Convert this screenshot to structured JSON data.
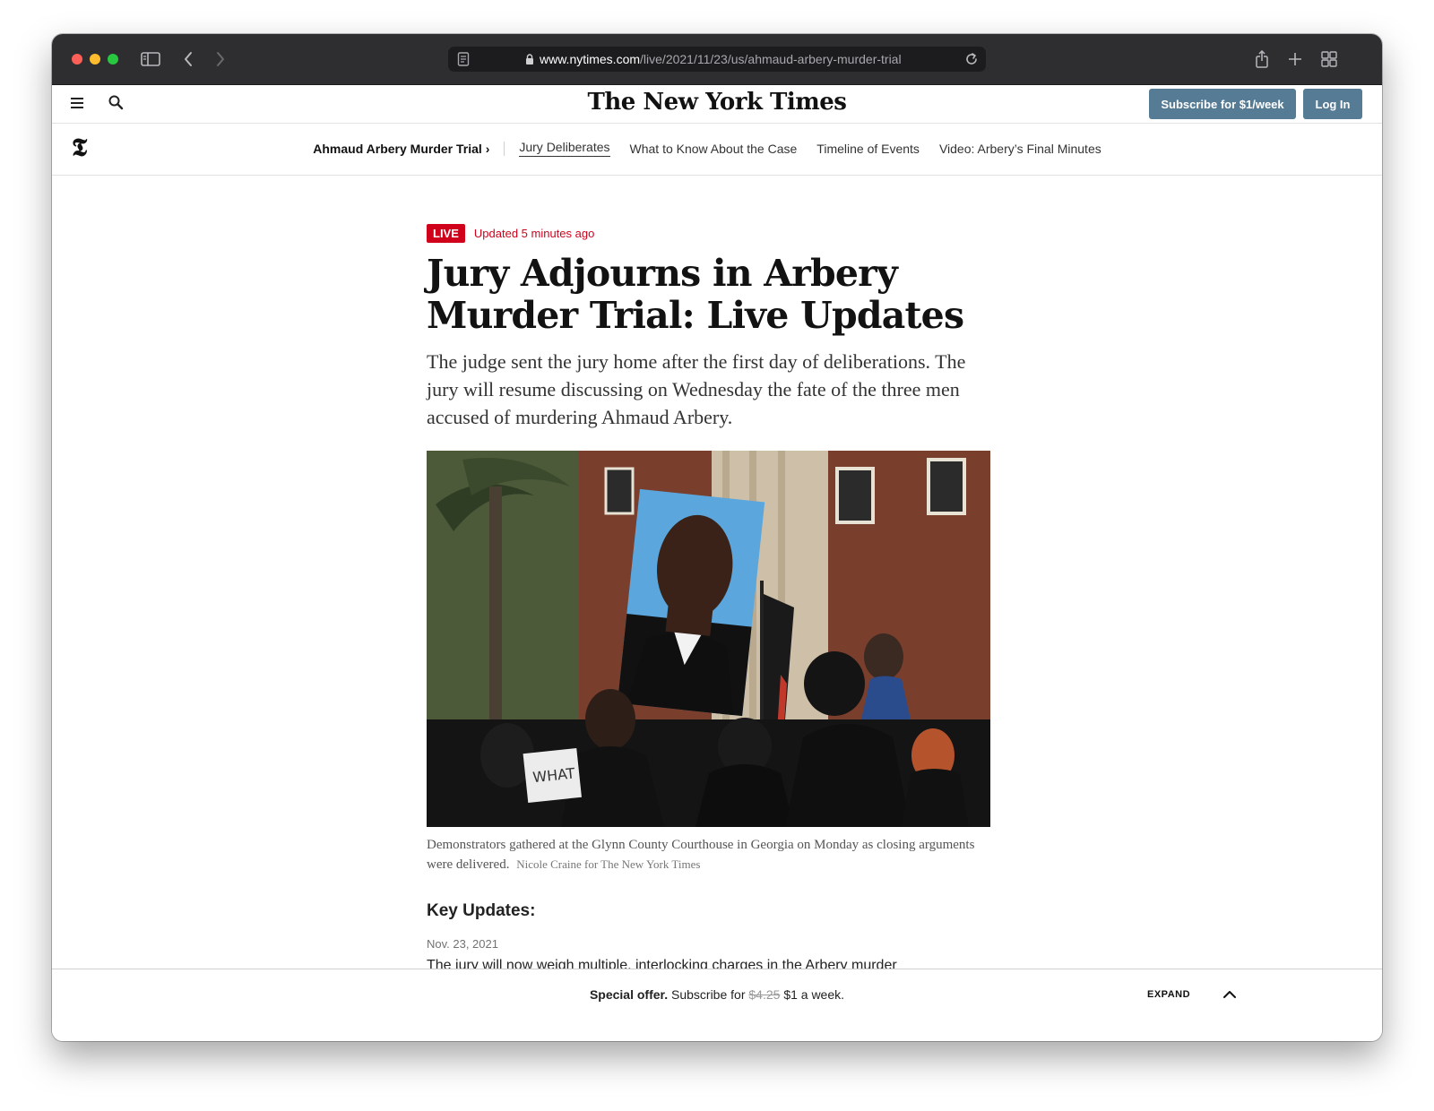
{
  "browser": {
    "url_domain": "www.nytimes.com",
    "url_path": "/live/2021/11/23/us/ahmaud-arbery-murder-trial",
    "icons": [
      "sidebar-icon",
      "back-icon",
      "forward-icon",
      "reader-icon",
      "lock-icon",
      "reload-icon",
      "share-icon",
      "new-tab-icon",
      "tab-overview-icon"
    ]
  },
  "header": {
    "masthead": "The New York Times",
    "subscribe_label": "Subscribe for $1/week",
    "login_label": "Log In",
    "accent_color": "#567b95"
  },
  "section_nav": {
    "trial_label": "Ahmaud Arbery Murder Trial",
    "trial_chevron": "›",
    "items": [
      {
        "label": "Jury Deliberates",
        "active": true
      },
      {
        "label": "What to Know About the Case",
        "active": false
      },
      {
        "label": "Timeline of Events",
        "active": false
      },
      {
        "label": "Video: Arbery’s Final Minutes",
        "active": false
      }
    ]
  },
  "article": {
    "live_label": "LIVE",
    "updated": "Updated 5 minutes ago",
    "headline": "Jury Adjourns in Arbery Murder Trial: Live Updates",
    "summary": "The judge sent the jury home after the first day of deliberations. The jury will resume discussing on Wednesday the fate of the three men accused of murdering Ahmaud Arbery.",
    "caption": "Demonstrators gathered at the Glynn County Courthouse in Georgia on Monday as closing arguments were delivered.",
    "credit": "Nicole Craine for The New York Times",
    "sign_text": "WHAT",
    "key_updates_title": "Key Updates:",
    "key_date": "Nov. 23, 2021",
    "key_link": "The jury will now weigh multiple, interlocking charges in the Arbery murder"
  },
  "offer": {
    "lead": "Special offer.",
    "text_before": "Subscribe for",
    "old_price": "$4.25",
    "text_after": "$1 a week.",
    "expand_label": "EXPAND"
  }
}
